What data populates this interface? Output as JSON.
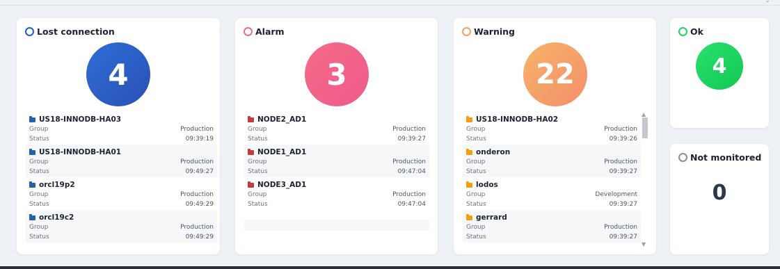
{
  "colors": {
    "lost": "#1f5fbf",
    "alarm": "#f06a8a",
    "warning": "#f4a261",
    "ok": "#1ed760",
    "not_monitored": "#8a8f98",
    "folder_blue": "#2563a8",
    "folder_red": "#c53a3a",
    "folder_orange": "#f59e0b"
  },
  "cards": {
    "lost": {
      "title": "Lost connection",
      "count": "4",
      "items": [
        {
          "name": "US18-INNODB-HA03",
          "group_label": "Group",
          "group": "Production",
          "status_label": "Status",
          "time": "09:39:19"
        },
        {
          "name": "US18-INNODB-HA01",
          "group_label": "Group",
          "group": "Production",
          "status_label": "Status",
          "time": "09:49:27"
        },
        {
          "name": "orcl19p2",
          "group_label": "Group",
          "group": "Production",
          "status_label": "Status",
          "time": "09:49:29"
        },
        {
          "name": "orcl19c2",
          "group_label": "Group",
          "group": "Production",
          "status_label": "Status",
          "time": "09:49:29"
        }
      ]
    },
    "alarm": {
      "title": "Alarm",
      "count": "3",
      "items": [
        {
          "name": "NODE2_AD1",
          "group_label": "Group",
          "group": "Production",
          "status_label": "Status",
          "time": "09:39:27"
        },
        {
          "name": "NODE1_AD1",
          "group_label": "Group",
          "group": "Production",
          "status_label": "Status",
          "time": "09:47:04"
        },
        {
          "name": "NODE3_AD1",
          "group_label": "Group",
          "group": "Production",
          "status_label": "Status",
          "time": "09:47:04"
        }
      ]
    },
    "warning": {
      "title": "Warning",
      "count": "22",
      "items": [
        {
          "name": "US18-INNODB-HA02",
          "group_label": "Group",
          "group": "Production",
          "status_label": "Status",
          "time": "09:39:26"
        },
        {
          "name": "onderon",
          "group_label": "Group",
          "group": "Production",
          "status_label": "Status",
          "time": "09:39:27"
        },
        {
          "name": "lodos",
          "group_label": "Group",
          "group": "Development",
          "status_label": "Status",
          "time": "09:39:27"
        },
        {
          "name": "gerrard",
          "group_label": "Group",
          "group": "Production",
          "status_label": "Status",
          "time": "09:39:27"
        }
      ]
    },
    "ok": {
      "title": "Ok",
      "count": "4"
    },
    "not_monitored": {
      "title": "Not monitored",
      "count": "0"
    }
  }
}
